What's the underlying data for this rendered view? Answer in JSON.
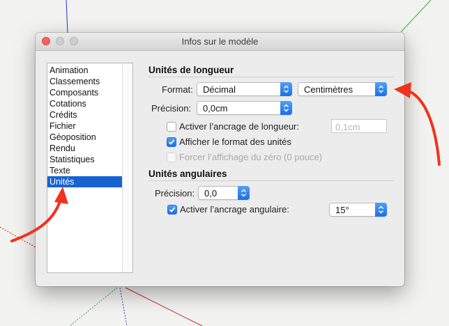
{
  "window": {
    "title": "Infos sur le modèle"
  },
  "sidebar": {
    "items": [
      {
        "label": "Animation"
      },
      {
        "label": "Classements"
      },
      {
        "label": "Composants"
      },
      {
        "label": "Cotations"
      },
      {
        "label": "Crédits"
      },
      {
        "label": "Fichier"
      },
      {
        "label": "Géoposition"
      },
      {
        "label": "Rendu"
      },
      {
        "label": "Statistiques"
      },
      {
        "label": "Texte"
      },
      {
        "label": "Unités"
      }
    ],
    "selected": "Unités"
  },
  "length_units": {
    "section_title": "Unités de longueur",
    "format_label": "Format:",
    "format_value": "Décimal",
    "unit_value": "Centimètres",
    "precision_label": "Précision:",
    "precision_value": "0,0cm",
    "snap_label": "Activer l’ancrage de longueur:",
    "snap_checked": false,
    "snap_value": "0,1cm",
    "show_format_label": "Afficher le format des unités",
    "show_format_checked": true,
    "force_zero_label": "Forcer l’affichage du zéro (0 pouce)",
    "force_zero_checked": false,
    "force_zero_disabled": true
  },
  "angle_units": {
    "section_title": "Unités angulaires",
    "precision_label": "Précision:",
    "precision_value": "0,0",
    "snap_label": "Activer l’ancrage angulaire:",
    "snap_checked": true,
    "snap_value": "15°"
  },
  "colors": {
    "accent": "#1b6fe6",
    "selection": "#1763d1",
    "annotation_arrow": "#f0321e"
  }
}
